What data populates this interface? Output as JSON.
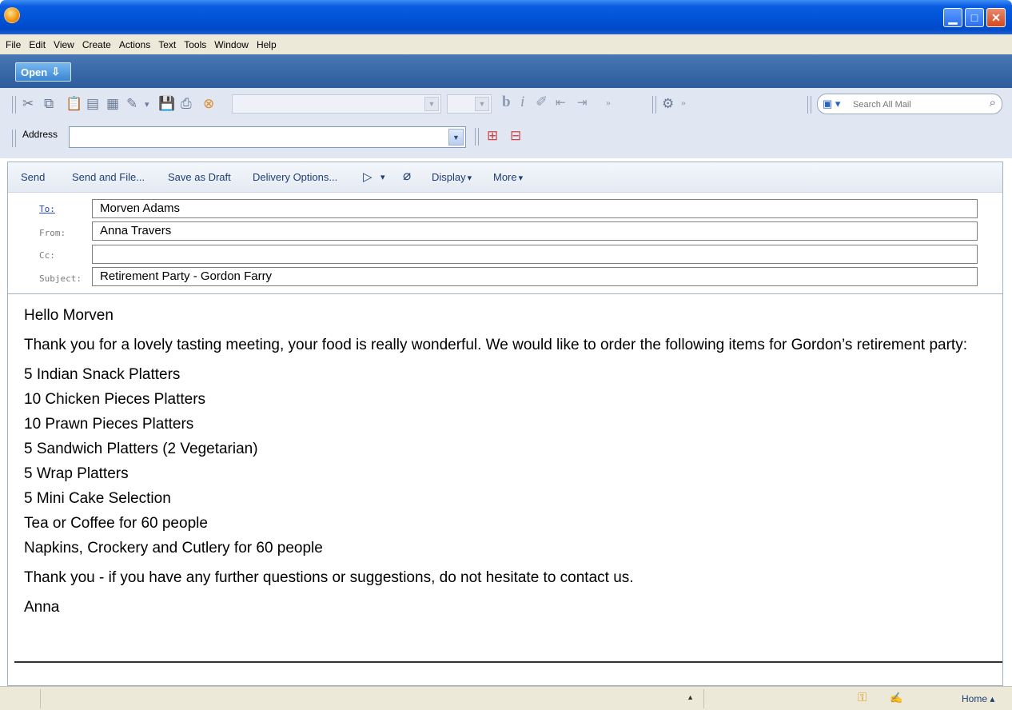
{
  "menu": {
    "items": [
      "File",
      "Edit",
      "View",
      "Create",
      "Actions",
      "Text",
      "Tools",
      "Window",
      "Help"
    ]
  },
  "toolbar": {
    "open_label": "Open",
    "search_placeholder": "Search All Mail",
    "address_label": "Address",
    "address_value": ""
  },
  "actions": {
    "send": "Send",
    "send_and_file": "Send and File...",
    "save_as_draft": "Save as Draft",
    "delivery_options": "Delivery Options...",
    "display": "Display",
    "more": "More"
  },
  "header": {
    "to_label": "To:",
    "to_value": "Morven Adams",
    "from_label": "From:",
    "from_value": "Anna Travers",
    "cc_label": "Cc:",
    "cc_value": "",
    "subject_label": "Subject:",
    "subject_value": "Retirement Party - Gordon Farry"
  },
  "body": {
    "greeting": "Hello Morven",
    "intro": "Thank you for a lovely tasting meeting, your food is really wonderful. We would like to order the following items for Gordon’s retirement party:",
    "items": [
      "5 Indian Snack Platters",
      "10 Chicken Pieces Platters",
      "10 Prawn Pieces Platters",
      "5 Sandwich Platters (2 Vegetarian)",
      "5 Wrap Platters",
      "5 Mini Cake Selection",
      "Tea or Coffee for 60 people",
      "Napkins, Crockery and Cutlery for 60 people"
    ],
    "closing": "Thank you - if you have any further questions or suggestions, do not hesitate to contact us.",
    "signature": "Anna"
  },
  "status": {
    "home_label": "Home"
  },
  "colors": {
    "titlebar": "#0052d6",
    "accent_link": "#2547c0",
    "action_text": "#1f3e74"
  }
}
